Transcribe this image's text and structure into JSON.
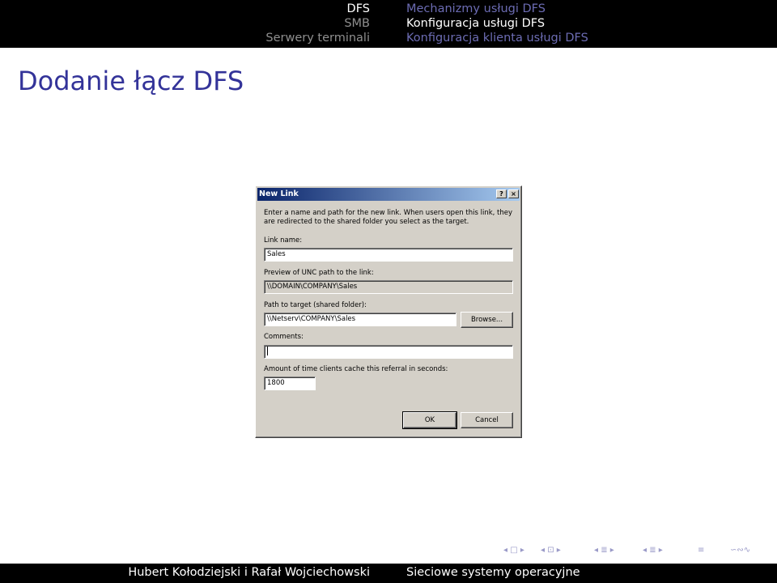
{
  "header": {
    "left_items": [
      "DFS",
      "SMB",
      "Serwery terminali"
    ],
    "right_items": [
      "Mechanizmy usługi DFS",
      "Konfiguracja usługi DFS",
      "Konfiguracja klienta usługi DFS"
    ]
  },
  "frame_title": "Dodanie łącz DFS",
  "dialog": {
    "title": "New Link",
    "help_button": "?",
    "close_button": "×",
    "intro_line1": "Enter a name and path for the new link. When users open this link, they",
    "intro_line2": "are redirected to the shared folder you select as the target.",
    "link_name_label": "Link name:",
    "link_name_value": "Sales",
    "preview_label": "Preview of UNC path to the link:",
    "preview_value": "\\\\DOMAIN\\COMPANY\\Sales",
    "path_label": "Path to target (shared folder):",
    "path_value": "\\\\Netserv\\COMPANY\\Sales",
    "browse_label": "Browse...",
    "comments_label": "Comments:",
    "comments_value": "",
    "cache_label": "Amount of time clients cache this referral in seconds:",
    "cache_value": "1800",
    "ok_label": "OK",
    "cancel_label": "Cancel"
  },
  "footer": {
    "authors": "Hubert Kołodziejski i Rafał Wojciechowski",
    "course": "Sieciowe systemy operacyjne"
  },
  "nav_symbols": {
    "frame": "◂ □ ▸",
    "subsection": "◂ ⊡ ▸",
    "section": "◂ ≣ ▸",
    "subsection2": "◂ ≣ ▸",
    "align": "≡",
    "search": "∽∾∿"
  }
}
